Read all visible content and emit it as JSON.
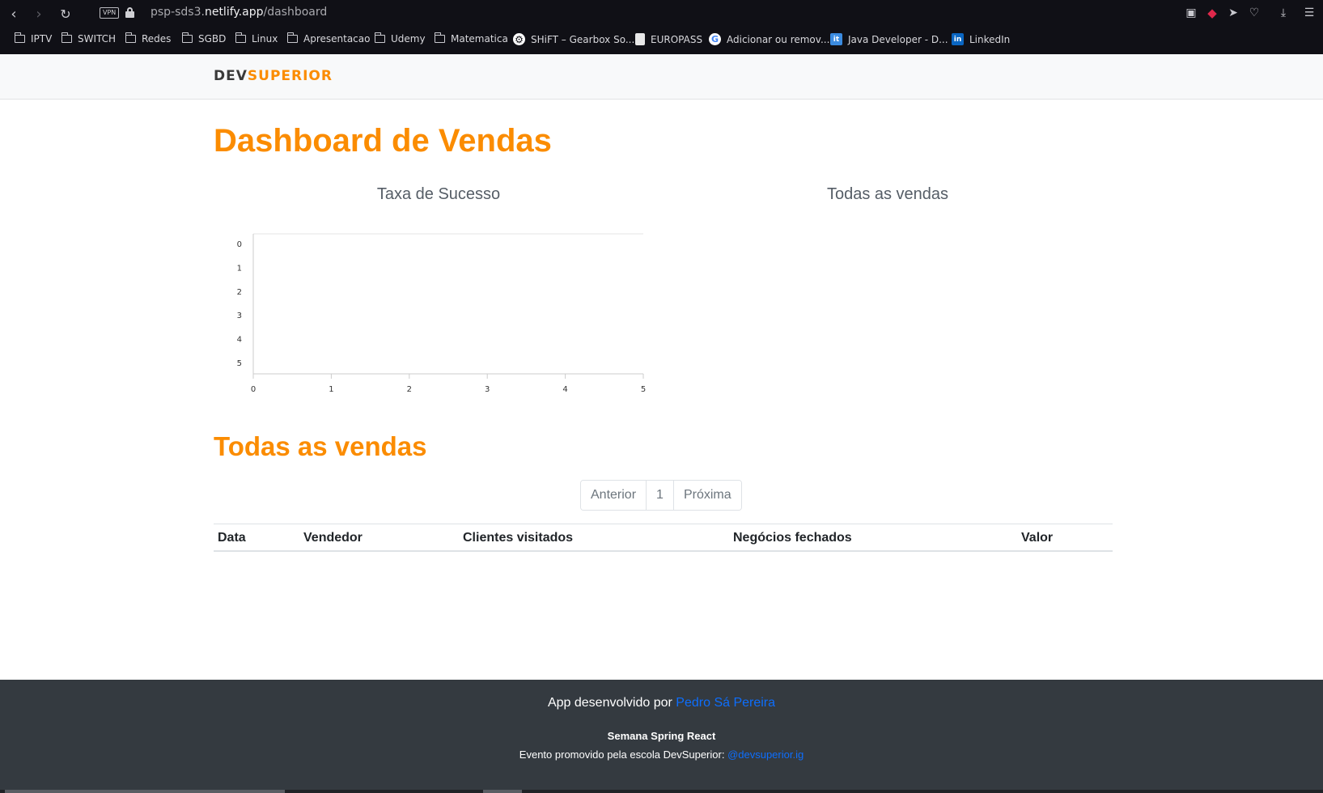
{
  "browser": {
    "url_prefix": "psp-sds3.",
    "url_domain": "netlify.app",
    "url_path": "/dashboard",
    "vpn_label": "VPN",
    "bookmarks": [
      {
        "label": "IPTV",
        "icon": "folder-icon"
      },
      {
        "label": "SWITCH",
        "icon": "folder-icon"
      },
      {
        "label": "Redes",
        "icon": "folder-icon"
      },
      {
        "label": "SGBD",
        "icon": "folder-icon"
      },
      {
        "label": "Linux",
        "icon": "folder-icon"
      },
      {
        "label": "Apresentacao",
        "icon": "folder-icon"
      },
      {
        "label": "Udemy",
        "icon": "folder-icon"
      },
      {
        "label": "Matematica",
        "icon": "folder-icon"
      },
      {
        "label": "SHiFT – Gearbox So...",
        "icon": "gearbox-icon"
      },
      {
        "label": "EUROPASS",
        "icon": "document-icon"
      },
      {
        "label": "Adicionar ou remov...",
        "icon": "google-icon"
      },
      {
        "label": "Java Developer - D...",
        "icon": "it-icon"
      },
      {
        "label": "LinkedIn",
        "icon": "linkedin-icon"
      }
    ]
  },
  "header": {
    "logo_dev": "DEV",
    "logo_superior": "SUPERIOR"
  },
  "main": {
    "title": "Dashboard de Vendas",
    "chart_left_title": "Taxa de Sucesso",
    "chart_right_title": "Todas as vendas",
    "section_title": "Todas as vendas"
  },
  "chart_data": {
    "type": "bar",
    "title": "Taxa de Sucesso",
    "categories": [],
    "values": [],
    "x_ticks": [
      "0",
      "1",
      "2",
      "3",
      "4",
      "5"
    ],
    "y_ticks": [
      "0",
      "1",
      "2",
      "3",
      "4",
      "5"
    ],
    "xlim": [
      0,
      5
    ],
    "ylim": [
      0,
      5
    ],
    "grid": false
  },
  "pagination": {
    "prev": "Anterior",
    "page": "1",
    "next": "Próxima"
  },
  "table": {
    "columns": [
      "Data",
      "Vendedor",
      "Clientes visitados",
      "Negócios fechados",
      "Valor"
    ],
    "rows": []
  },
  "footer": {
    "line1_prefix": "App desenvolvido por ",
    "line1_link": "Pedro Sá Pereira",
    "line2": "Semana Spring React",
    "line3_prefix": "Evento promovido pela escola DevSuperior: ",
    "line3_link": "@devsuperior.ig"
  },
  "colors": {
    "accent": "#fb8c00",
    "link": "#0d6efd",
    "footer_bg": "#343a40"
  }
}
